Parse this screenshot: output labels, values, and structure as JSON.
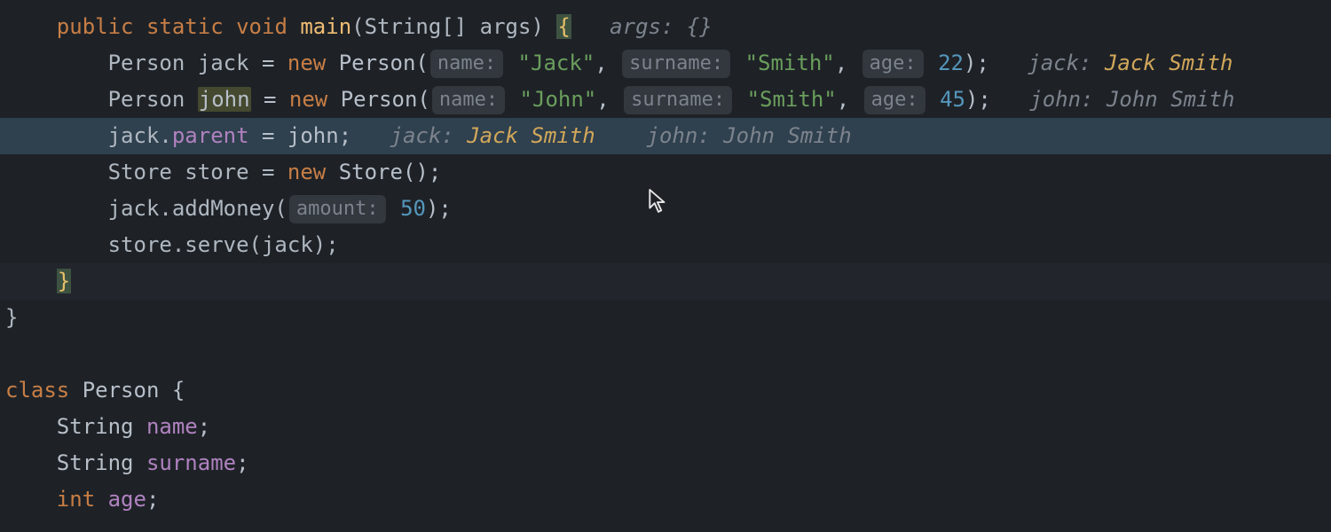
{
  "code": {
    "line1": {
      "kw_public": "public",
      "kw_static": "static",
      "kw_void": "void",
      "method": "main",
      "params": "(String[] args)",
      "brace": "{",
      "inlay_var": "args:",
      "inlay_val": " {}"
    },
    "line2": {
      "decl": "Person jack",
      "eq": " = ",
      "kw_new": "new",
      "ctor": " Person(",
      "h_name": "name:",
      "s_name": "\"Jack\"",
      "c1": ", ",
      "h_sur": "surname:",
      "s_sur": "\"Smith\"",
      "c2": ", ",
      "h_age": "age:",
      "n_age": "22",
      "end": ");",
      "inlay_var": "jack:",
      "inlay_val": " Jack Smith"
    },
    "line3": {
      "decl_pre": "Person ",
      "john": "john",
      "eq": " = ",
      "kw_new": "new",
      "ctor": " Person(",
      "h_name": "name:",
      "s_name": "\"John\"",
      "c1": ", ",
      "h_sur": "surname:",
      "s_sur": "\"Smith\"",
      "c2": ", ",
      "h_age": "age:",
      "n_age": "45",
      "end": ");",
      "inlay_var": "john:",
      "inlay_val": " John Smith"
    },
    "line4": {
      "obj": "jack.",
      "field": "parent",
      "rest": " = john;",
      "inlay1_var": "jack:",
      "inlay1_val": " Jack Smith",
      "inlay2_var": "john:",
      "inlay2_val": " John Smith"
    },
    "line5": {
      "decl": "Store store = ",
      "kw_new": "new",
      "rest": " Store();"
    },
    "line6": {
      "pre": "jack.addMoney(",
      "h_amount": "amount:",
      "n_amount": "50",
      "end": ");"
    },
    "line7": {
      "text": "store.serve(jack);"
    },
    "line8": {
      "brace": "}"
    },
    "line9": {
      "brace": "}"
    },
    "line11": {
      "kw_class": "class",
      "rest": " Person {"
    },
    "line12": {
      "pre": "String ",
      "field": "name",
      "semi": ";"
    },
    "line13": {
      "pre": "String ",
      "field": "surname",
      "semi": ";"
    },
    "line14": {
      "kw_int": "int",
      "sp": " ",
      "field": "age",
      "semi": ";"
    }
  }
}
